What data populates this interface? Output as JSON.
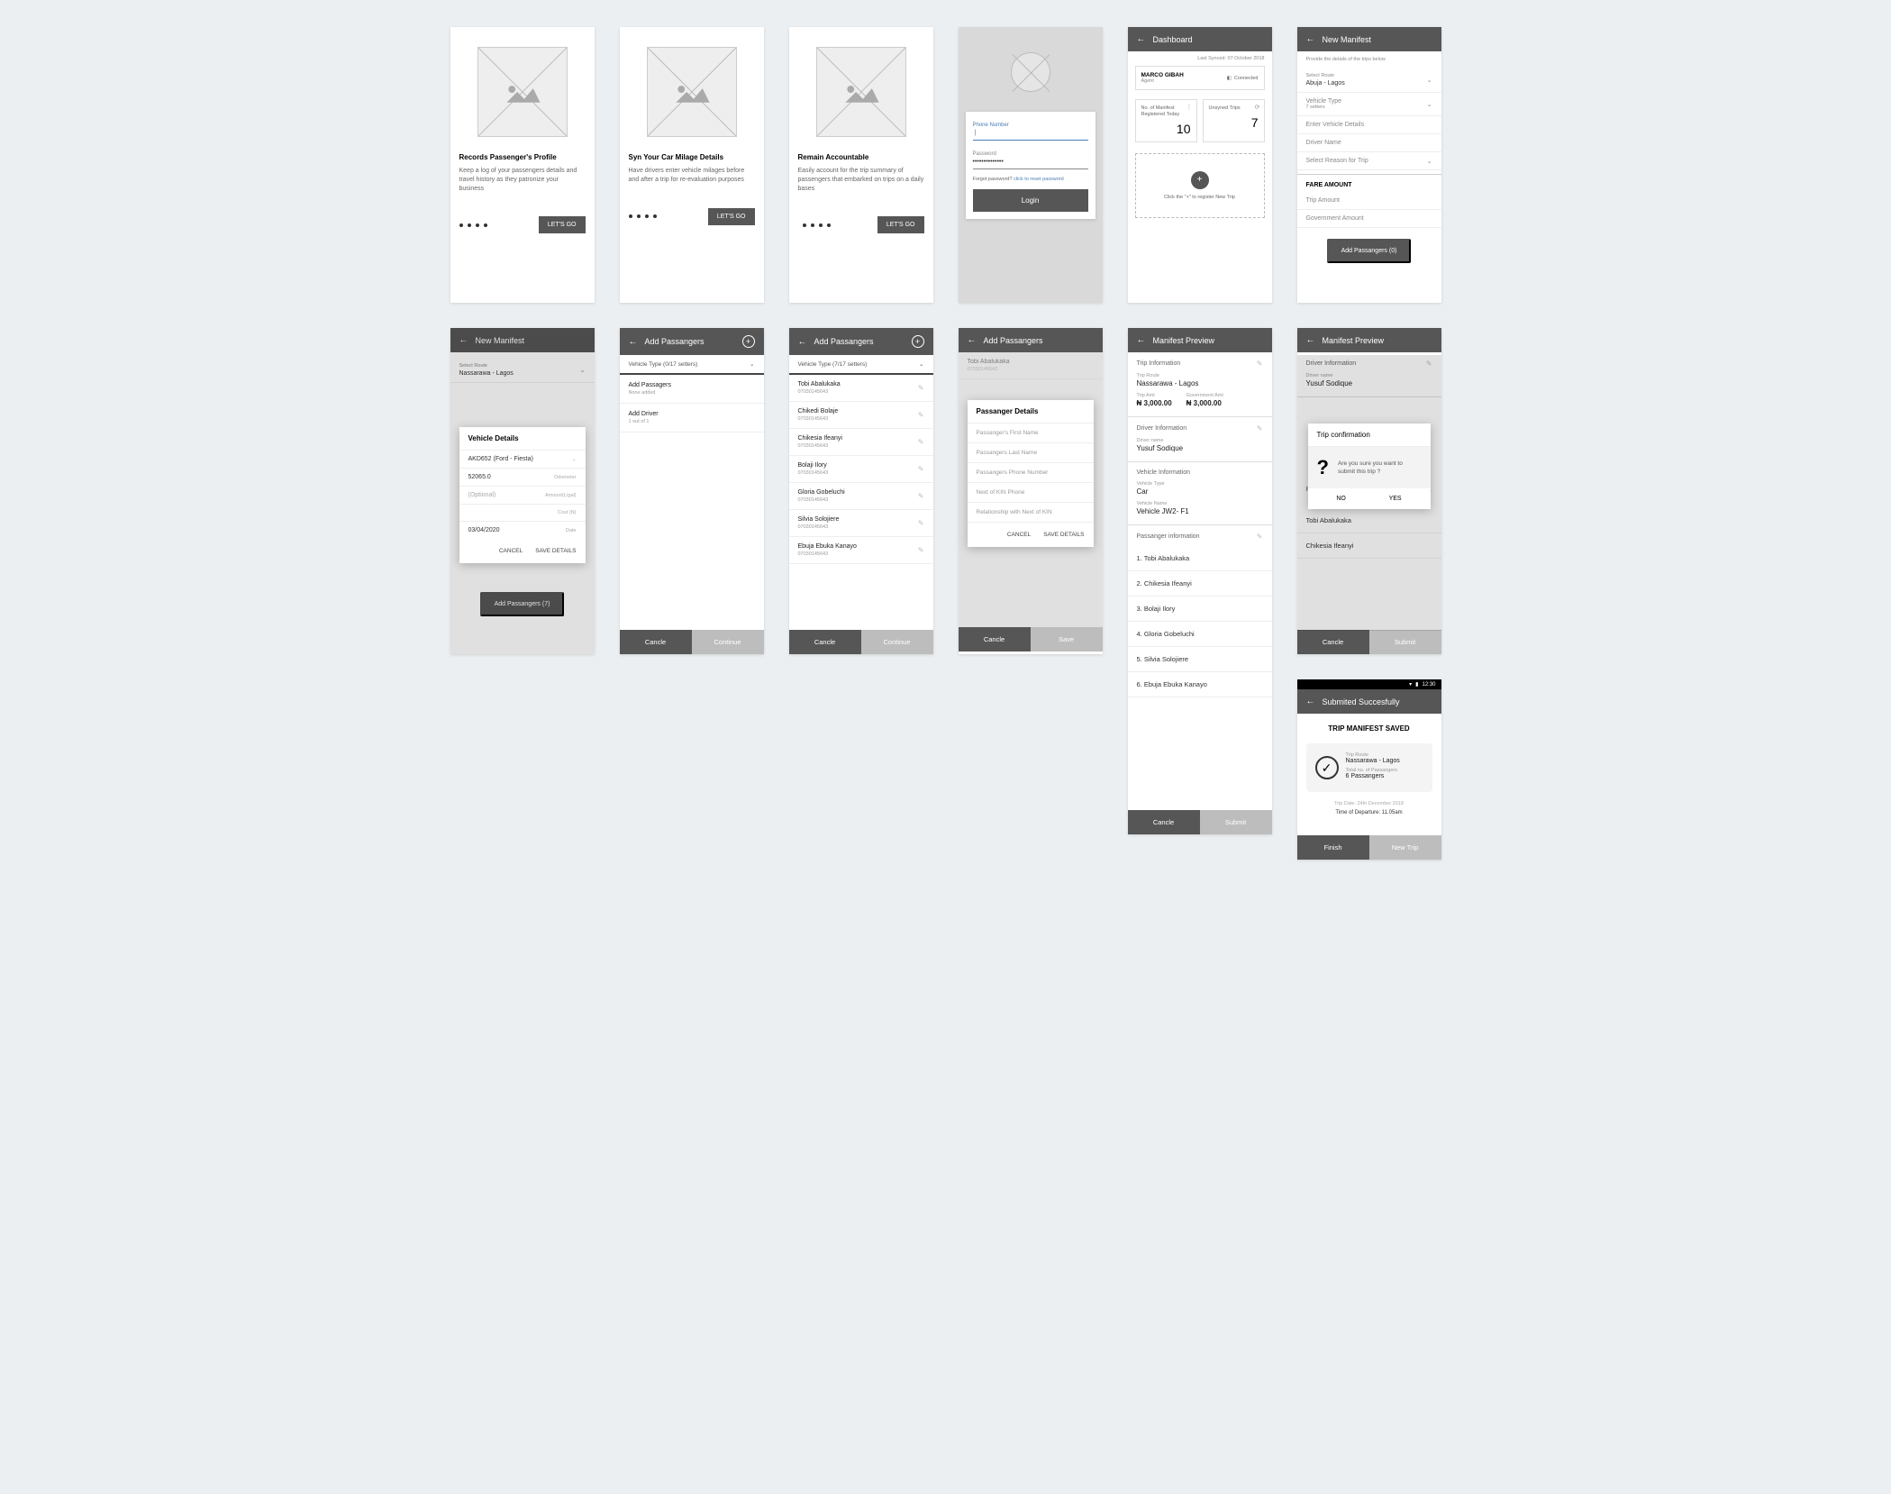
{
  "onboarding": [
    {
      "title": "Records Passenger's Profile",
      "body": "Keep a log of your passengers  details and travel history as they patronize your business",
      "cta": "LET'S GO"
    },
    {
      "title": "Syn Your Car Milage Details",
      "body": "Have drivers enter vehicle milages before and after a trip for re-evaluation purposes",
      "cta": "LET'S GO"
    },
    {
      "title": "Remain Accountable",
      "body": "Easily account for the trip summary of passengers that embarked on trips on a daily bases",
      "cta": "LET'S GO"
    }
  ],
  "login": {
    "phone_label": "Phone Number",
    "password_label": "Password",
    "password_value": "••••••••••••••",
    "forgot_pre": "Forgot password? ",
    "forgot_link": "click to reset password",
    "button": "Login"
  },
  "dashboard": {
    "title": "Dashboard",
    "last_synced": "Last Synced: 07 October 2018",
    "user_name": "MARCO GIBAH",
    "user_role": "Agent",
    "connected": "Connected",
    "stat1_label": "No. of Manifest Registered Today",
    "stat1_value": "10",
    "stat2_label": "Unsyned Trips",
    "stat2_value": "7",
    "add_hint": "Click the \"+\" to register New Trip"
  },
  "new_manifest": {
    "title": "New Manifest",
    "helper": "Provide the details of the trips below",
    "route_label": "Select Route",
    "route_value": "Abuja - Lagos",
    "veh_type_label": "Vehicle Type",
    "veh_type_hint": "7 setters",
    "veh_details_ph": "Enter Vehicle Details",
    "driver_ph": "Driver Name",
    "reason_ph": "Select Reason for Trip",
    "fare_head": "FARE AMOUNT",
    "trip_amt_ph": "Trip Amount",
    "gov_amt_ph": "Government Amount",
    "add_btn": "Add Passangers (0)"
  },
  "new_manifest2": {
    "route_label": "Select Route",
    "route_value": "Nassarawa - Lagos",
    "modal_title": "Vehicle Details",
    "vehicle": "AKD652 (Ford - Fiesta)",
    "odo_val": "52065.0",
    "odo_lbl": "Odometer",
    "amt_ph": "(Optional)",
    "amt_lbl": "Amount(L/gal)",
    "cost_lbl": "Cost (N)",
    "date_val": "03/04/2020",
    "date_lbl": "Date",
    "cancel": "CANCEL",
    "save": "SAVE DETAILS",
    "add_btn": "Add Passangers (7)"
  },
  "add_pass1": {
    "title": "Add Passangers",
    "vt": "Vehicle Type  (0/17 setters)",
    "s1t": "Add Passagers",
    "s1s": "None added",
    "s2t": "Add Driver",
    "s2s": "1 out of 1",
    "cancel": "Cancle",
    "cont": "Continue"
  },
  "add_pass2": {
    "title": "Add Passangers",
    "vt": "Vehicle Type  (7/17 setters)",
    "people": [
      {
        "n": "Tobi Abalukaka",
        "p": "07030145643"
      },
      {
        "n": "Chikedi Bolaje",
        "p": "07030145643"
      },
      {
        "n": "Chikesia Ifeanyi",
        "p": "07030145643"
      },
      {
        "n": "Bolaji Ilory",
        "p": "07030145643"
      },
      {
        "n": "Gloria Gobeluchi",
        "p": "07030145643"
      },
      {
        "n": "Silvia Solojiere",
        "p": "07030145643"
      },
      {
        "n": "Ebuja Ebuka Kanayo",
        "p": "07030145643"
      }
    ],
    "cancel": "Cancle",
    "cont": "Continue"
  },
  "pass_detail": {
    "bg_name": "Tobi Abalukaka",
    "bg_phone": "07030145643",
    "title": "Passanger Details",
    "fields": [
      "Passanger's First Name",
      "Passangers Last Name",
      "Passangers Phone Number",
      "Next of KIN Phone",
      "Relationship with Next of KIN"
    ],
    "cancel": "CANCEL",
    "save": "SAVE DETAILS",
    "f_cancel": "Cancle",
    "f_save": "Save"
  },
  "preview": {
    "title": "Manifest Preview",
    "trip_info": "Trip Information",
    "route_l": "Trip Route",
    "route_v": "Nassarawa - Lagos",
    "tamt_l": "Trip Amt",
    "tamt_v": "₦ 3,000.00",
    "gamt_l": "Government Amt",
    "gamt_v": "₦ 3,000.00",
    "driver_info": "Driver Information",
    "dname_l": "Driver name",
    "dname_v": "Yusuf Sodique",
    "veh_info": "Vehicle Information",
    "vtype_l": "Vehicle Type",
    "vtype_v": "Car",
    "vname_l": "Vehicle Name",
    "vname_v": "Vehicle JW2- F1",
    "pass_info": "Passanger information",
    "passengers": [
      "Tobi Abalukaka",
      "Chikesia Ifeanyi",
      "Bolaji Ilory",
      "Gloria Gobeluchi",
      "Silvia Solojiere",
      "Ebuja Ebuka Kanayo"
    ],
    "cancel": "Cancle",
    "submit": "Submit"
  },
  "preview2": {
    "driver_info": "Driver Information",
    "dname_l": "Driver name",
    "dname_v": "Yusuf Sodique",
    "conf_title": "Trip confirmation",
    "conf_body": "Are you sure you want to submit this trip ?",
    "no": "NO",
    "yes": "YES",
    "pass_info": "Passanger information",
    "p1": "Tobi Abalukaka",
    "p2": "Chikesia Ifeanyi",
    "cancel": "Cancle",
    "submit": "Submit"
  },
  "success": {
    "status_time": "12:30",
    "title": "Submited Succesfully",
    "head": "TRIP MANIFEST SAVED",
    "route_l": "Trip Route",
    "route_v": "Nassarawa - Lagos",
    "count_l": "Total no. of Passangers",
    "count_v": "6 Passangers",
    "date": "Trip Date: 24th December 2018",
    "time": "Time of Departure: 11.05am",
    "finish": "Finish",
    "newtrip": "New Trip"
  }
}
